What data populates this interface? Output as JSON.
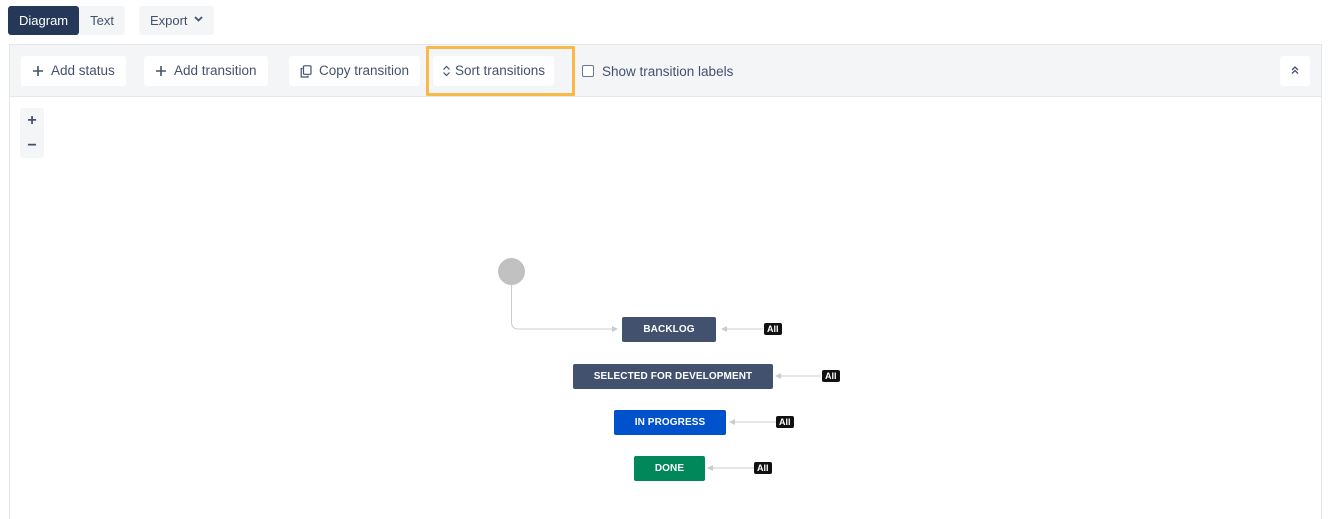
{
  "view_toggle": {
    "diagram_label": "Diagram",
    "text_label": "Text",
    "export_label": "Export"
  },
  "toolbar": {
    "add_status_label": "Add status",
    "add_transition_label": "Add transition",
    "copy_transition_label": "Copy transition",
    "sort_transitions_label": "Sort transitions",
    "show_labels_label": "Show transition labels"
  },
  "zoom": {
    "in_label": "+",
    "out_label": "−"
  },
  "statuses": [
    {
      "name": "BACKLOG",
      "color": "#42526e",
      "tag": "All"
    },
    {
      "name": "SELECTED FOR DEVELOPMENT",
      "color": "#42526e",
      "tag": "All"
    },
    {
      "name": "IN PROGRESS",
      "color": "#0052cc",
      "tag": "All"
    },
    {
      "name": "DONE",
      "color": "#00875a",
      "tag": "All"
    }
  ],
  "colors": {
    "highlight": "#f9b949",
    "toggle_active": "#253858",
    "start_node": "#c1c1c1"
  }
}
